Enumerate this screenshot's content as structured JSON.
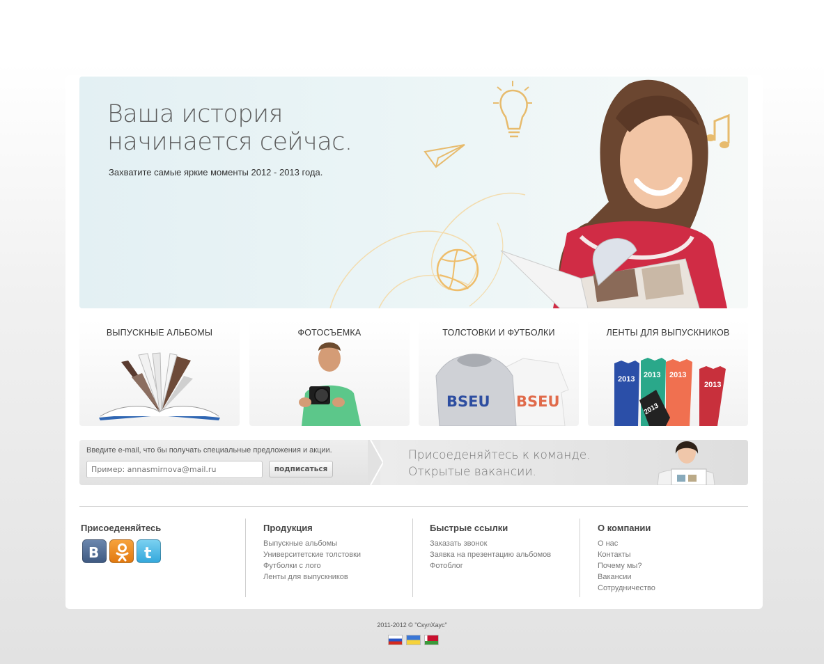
{
  "hero": {
    "title_line1": "Ваша история",
    "title_line2": "начинается сейчас.",
    "subtitle": "Захватите самые яркие моменты 2012 - 2013 года."
  },
  "tiles": [
    {
      "label": "ВЫПУСКНЫЕ АЛЬБОМЫ",
      "icon": "open-album-image"
    },
    {
      "label": "ФОТОСЪЕМКА",
      "icon": "photographer-image"
    },
    {
      "label": "ТОЛСТОВКИ И ФУТБОЛКИ",
      "icon": "hoodie-tshirt-image",
      "print": "BSEU"
    },
    {
      "label": "ЛЕНТЫ ДЛЯ ВЫПУСКНИКОВ",
      "icon": "graduation-ribbons-image",
      "year": "2013"
    }
  ],
  "subscribe": {
    "text": "Введите e-mail, что бы получать специальные предложения и акции.",
    "placeholder": "Пример: annasmirnova@mail.ru",
    "button": "подписаться"
  },
  "vacancy": {
    "line1": "Присоеденяйтесь к команде.",
    "line2": "Открытые вакансии."
  },
  "footer": {
    "join": {
      "title": "Присоеденяйтесь",
      "social": [
        {
          "name": "vkontakte-icon",
          "letter": "B",
          "color": "#4f6d96"
        },
        {
          "name": "odnoklassniki-icon",
          "letter": "ok",
          "color": "#f28a15"
        },
        {
          "name": "twitter-icon",
          "letter": "t",
          "color": "#3fb6e8"
        }
      ]
    },
    "products": {
      "title": "Продукция",
      "links": [
        "Выпускные альбомы",
        "Университетские толстовки",
        "Футболки с лого",
        "Ленты для выпускников"
      ]
    },
    "quick": {
      "title": "Быстрые ссылки",
      "links": [
        "Заказать звонок",
        "Заявка на презентацию альбомов",
        "Фотоблог"
      ]
    },
    "company": {
      "title": "О компании",
      "links": [
        "О нас",
        "Контакты",
        "Почему мы?",
        "Вакансии",
        "Сотрудничество"
      ]
    }
  },
  "copyright": "2011-2012 ©  \"СкулХаус\"",
  "flags": [
    "russia-flag",
    "ukraine-flag",
    "belarus-flag"
  ],
  "colors": {
    "accent": "#f0c070",
    "shirt_red": "#c8283c",
    "ribbon_blue": "#2b4fa8",
    "ribbon_green": "#2aa88a",
    "ribbon_orange": "#f07050",
    "ribbon_red": "#c8303c"
  }
}
